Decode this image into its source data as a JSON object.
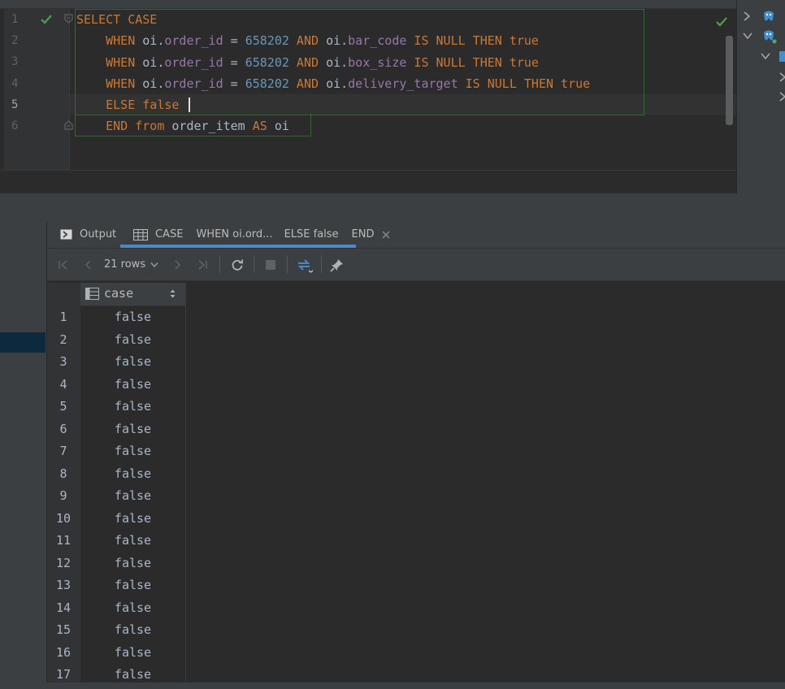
{
  "editor": {
    "line_numbers": [
      "1",
      "2",
      "3",
      "4",
      "5",
      "6"
    ],
    "lines": [
      [
        {
          "t": "SELECT CASE",
          "c": "kw"
        }
      ],
      [
        {
          "t": "    WHEN ",
          "c": "kw"
        },
        {
          "t": "oi.",
          "c": "plain"
        },
        {
          "t": "order_id",
          "c": "fld"
        },
        {
          "t": " = ",
          "c": "plain"
        },
        {
          "t": "658202",
          "c": "num"
        },
        {
          "t": " AND ",
          "c": "kw"
        },
        {
          "t": "oi.",
          "c": "plain"
        },
        {
          "t": "bar_code",
          "c": "fld"
        },
        {
          "t": " IS NULL THEN true",
          "c": "kw"
        }
      ],
      [
        {
          "t": "    WHEN ",
          "c": "kw"
        },
        {
          "t": "oi.",
          "c": "plain"
        },
        {
          "t": "order_id",
          "c": "fld"
        },
        {
          "t": " = ",
          "c": "plain"
        },
        {
          "t": "658202",
          "c": "num"
        },
        {
          "t": " AND ",
          "c": "kw"
        },
        {
          "t": "oi.",
          "c": "plain"
        },
        {
          "t": "box_size",
          "c": "fld"
        },
        {
          "t": " IS NULL THEN true",
          "c": "kw"
        }
      ],
      [
        {
          "t": "    WHEN ",
          "c": "kw"
        },
        {
          "t": "oi.",
          "c": "plain"
        },
        {
          "t": "order_id",
          "c": "fld"
        },
        {
          "t": " = ",
          "c": "plain"
        },
        {
          "t": "658202",
          "c": "num"
        },
        {
          "t": " AND ",
          "c": "kw"
        },
        {
          "t": "oi.",
          "c": "plain"
        },
        {
          "t": "delivery_target",
          "c": "fld"
        },
        {
          "t": " IS NULL THEN true",
          "c": "kw"
        }
      ],
      [
        {
          "t": "    ELSE false",
          "c": "kw"
        }
      ],
      [
        {
          "t": "    END from ",
          "c": "kw"
        },
        {
          "t": "order_item ",
          "c": "plain"
        },
        {
          "t": "AS ",
          "c": "kw"
        },
        {
          "t": "oi",
          "c": "plain"
        }
      ]
    ]
  },
  "tabs": {
    "output_label": "Output",
    "result_tabs": [
      "CASE",
      "WHEN oi.ord...",
      "ELSE false",
      "END"
    ]
  },
  "toolbar": {
    "rows_label": "21 rows"
  },
  "grid": {
    "column_header": "case",
    "row_numbers": [
      "1",
      "2",
      "3",
      "4",
      "5",
      "6",
      "7",
      "8",
      "9",
      "10",
      "11",
      "12",
      "13",
      "14",
      "15",
      "16",
      "17"
    ],
    "values": [
      "false",
      "false",
      "false",
      "false",
      "false",
      "false",
      "false",
      "false",
      "false",
      "false",
      "false",
      "false",
      "false",
      "false",
      "false",
      "false",
      "false"
    ]
  },
  "colors": {
    "keyword": "#cc7832",
    "field": "#9876aa",
    "number": "#6897bb",
    "text": "#a9b7c6",
    "check_green": "#4e9a4e",
    "accent_blue": "#4a88c7"
  }
}
